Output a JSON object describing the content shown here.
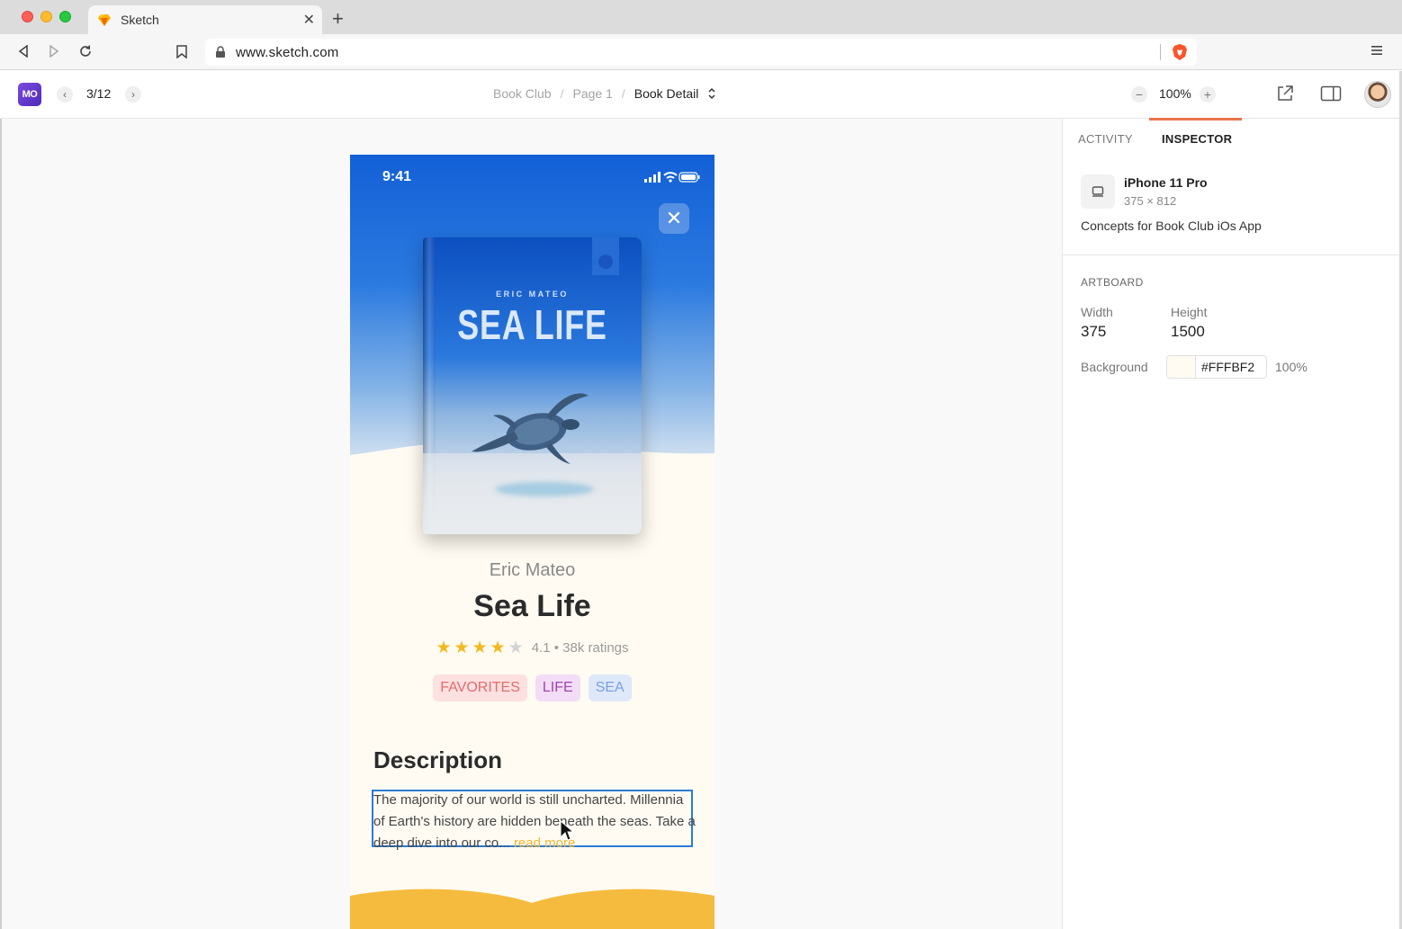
{
  "browser": {
    "tab_title": "Sketch",
    "url": "www.sketch.com"
  },
  "header": {
    "logo_text": "MO",
    "page_count": "3/12",
    "breadcrumb": [
      "Book Club",
      "Page 1",
      "Book Detail"
    ],
    "zoom": "100%"
  },
  "artboard": {
    "status_time": "9:41",
    "book_cover_author": "ERIC MATEO",
    "book_cover_title": "SEA LIFE",
    "author": "Eric Mateo",
    "title": "Sea Life",
    "rating_value": 4.1,
    "stars_filled": 4,
    "stars_total": 5,
    "rating_text": "4.1 • 38k ratings",
    "tags": [
      "FAVORITES",
      "LIFE",
      "SEA"
    ],
    "description_heading": "Description",
    "description_text": "The majority of our world is still uncharted. Millennia of Earth's history are hidden beneath the seas. Take a deep dive into our co...",
    "read_more": "read more"
  },
  "inspector": {
    "tabs": [
      "ACTIVITY",
      "INSPECTOR"
    ],
    "active_tab": "INSPECTOR",
    "device_name": "iPhone 11 Pro",
    "device_size": "375 × 812",
    "device_description": "Concepts for Book Club iOs App",
    "section_label": "ARTBOARD",
    "width_label": "Width",
    "width_value": "375",
    "height_label": "Height",
    "height_value": "1500",
    "background_label": "Background",
    "background_hex": "#FFFBF2",
    "background_opacity": "100%"
  },
  "colors": {
    "accent": "#e8734a",
    "star": "#f4b81f",
    "selection": "#2b7bd6",
    "artboard_bg": "#FFFBF2"
  }
}
